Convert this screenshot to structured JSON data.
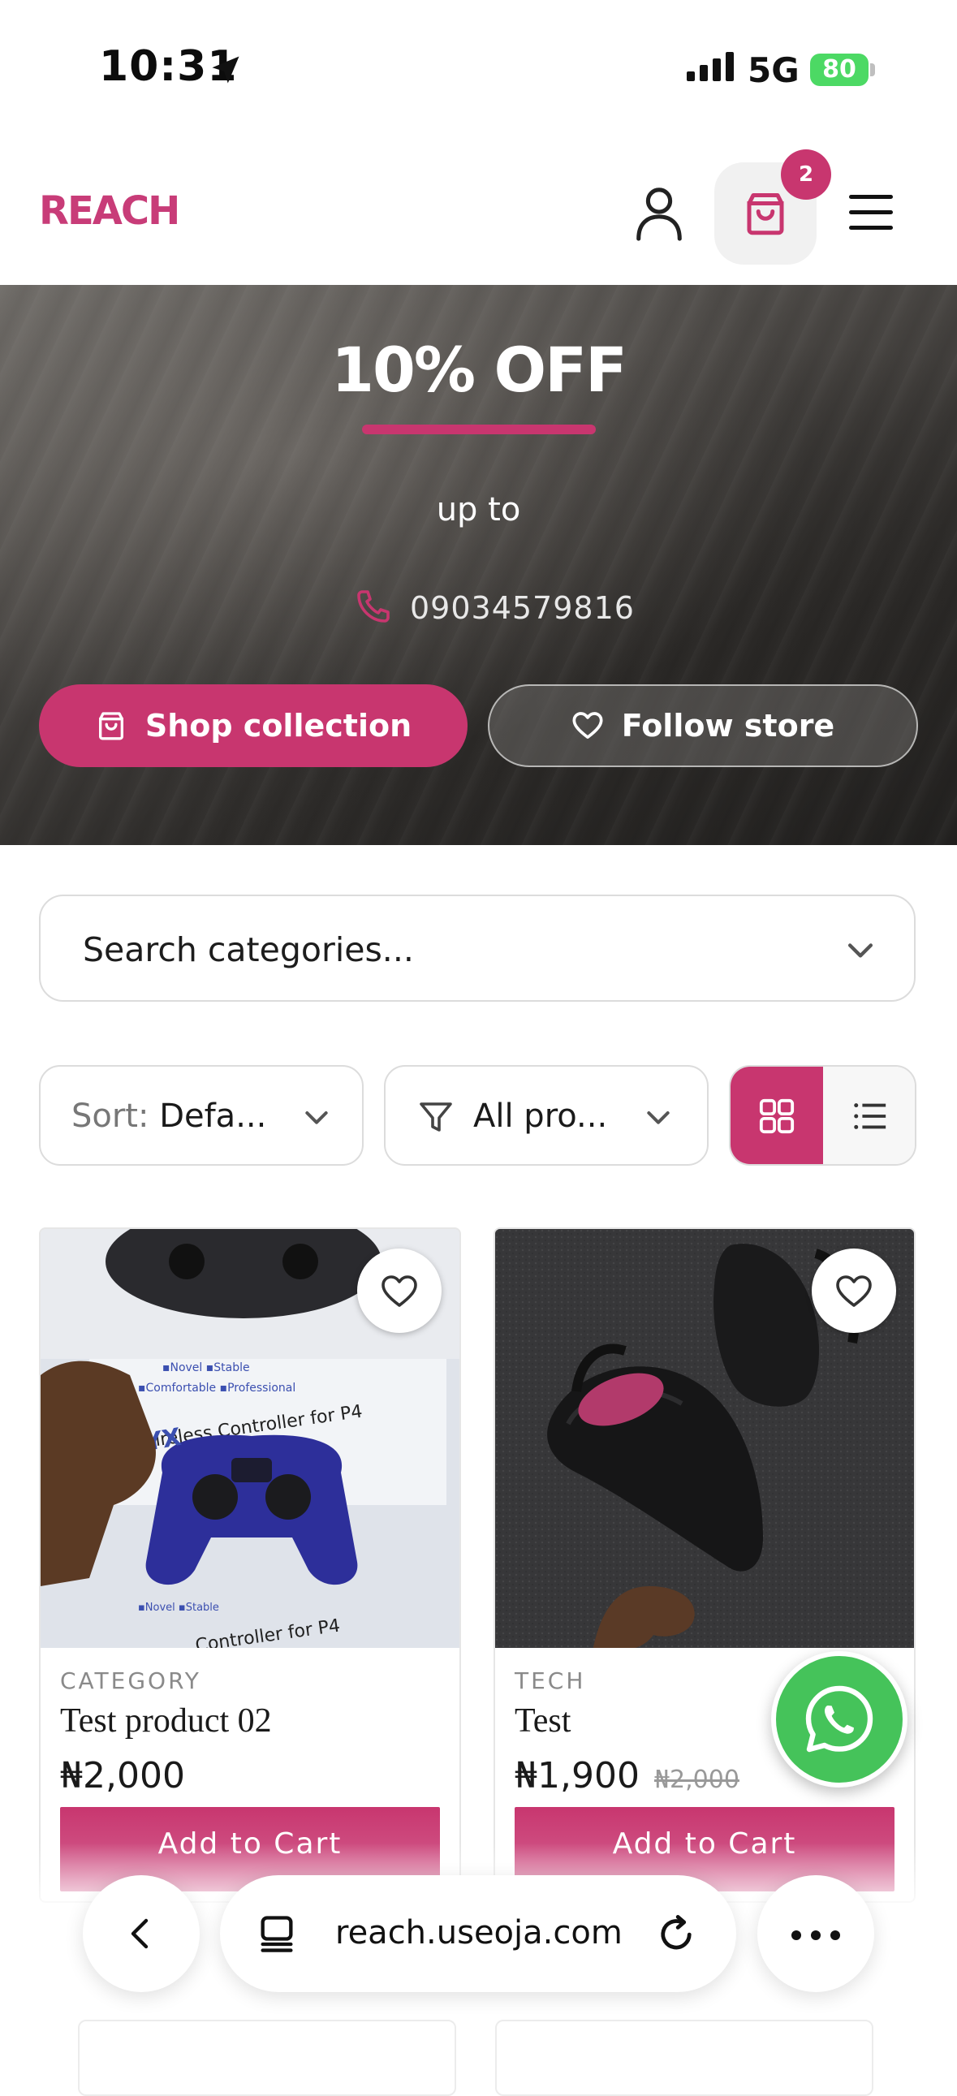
{
  "status_bar": {
    "time": "10:31",
    "network": "5G",
    "battery": "80"
  },
  "header": {
    "logo": "REACH",
    "cart_count": "2"
  },
  "hero": {
    "title": "10% OFF",
    "subtitle": "up to",
    "phone": "09034579816",
    "shop_label": "Shop collection",
    "follow_label": "Follow store"
  },
  "category_search": {
    "label": "Search categories..."
  },
  "filters": {
    "sort_prefix": "Sort: ",
    "sort_value": "Defa...",
    "filter_value": "All pro...",
    "view_mode": "grid"
  },
  "products": [
    {
      "category": "CATEGORY",
      "name": "Test product 02",
      "price": "₦2,000",
      "old_price": "",
      "button": "Add to Cart"
    },
    {
      "category": "TECH",
      "name": "Test",
      "price": "₦1,900",
      "old_price": "₦2,000",
      "button": "Add to Cart"
    }
  ],
  "browser": {
    "url": "reach.useoja.com"
  },
  "colors": {
    "accent": "#c8366f",
    "whatsapp": "#45c35a"
  },
  "icons": [
    "location-arrow-icon",
    "user-icon",
    "shopping-bag-icon",
    "menu-icon",
    "phone-icon",
    "heart-icon",
    "chevron-down-icon",
    "filter-icon",
    "grid-icon",
    "list-icon",
    "whatsapp-icon",
    "back-icon",
    "tabs-icon",
    "reload-icon",
    "more-icon"
  ]
}
